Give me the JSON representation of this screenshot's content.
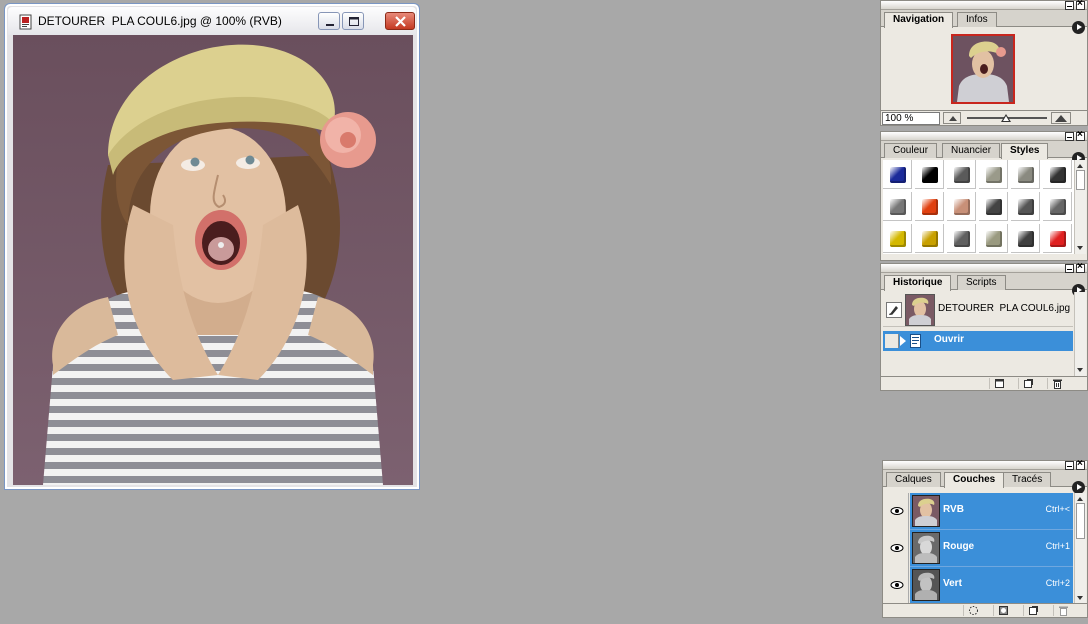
{
  "document": {
    "title": "DETOURER  PLA COUL6.jpg @ 100% (RVB)"
  },
  "navigation": {
    "tabs": [
      "Navigation",
      "Infos"
    ],
    "zoom": "100 %"
  },
  "styles": {
    "tabs": [
      "Couleur",
      "Nuancier",
      "Styles"
    ],
    "swatches": [
      "#1b2a9a",
      "#000000",
      "#5a5a5a",
      "#9a9a8a",
      "#8a8a80",
      "#333333",
      "#777777",
      "#e04010",
      "#c89078",
      "#444444",
      "#555555",
      "#666666",
      "#d4b800",
      "#c8a000",
      "#606060",
      "#9a9a80",
      "#404040",
      "#e02020"
    ]
  },
  "history": {
    "tabs": [
      "Historique",
      "Scripts"
    ],
    "snapshot_label": "DETOURER  PLA COUL6.jpg",
    "state_label": "Ouvrir"
  },
  "channels": {
    "tabs": [
      "Calques",
      "Couches",
      "Tracés"
    ],
    "rows": [
      {
        "name": "RVB",
        "shortcut": "Ctrl+<"
      },
      {
        "name": "Rouge",
        "shortcut": "Ctrl+1"
      },
      {
        "name": "Vert",
        "shortcut": "Ctrl+2"
      }
    ]
  },
  "colors": {
    "accent": "#3b8fd9",
    "workspace": "#a8a8a8",
    "palette_bg": "#ece9e2"
  }
}
